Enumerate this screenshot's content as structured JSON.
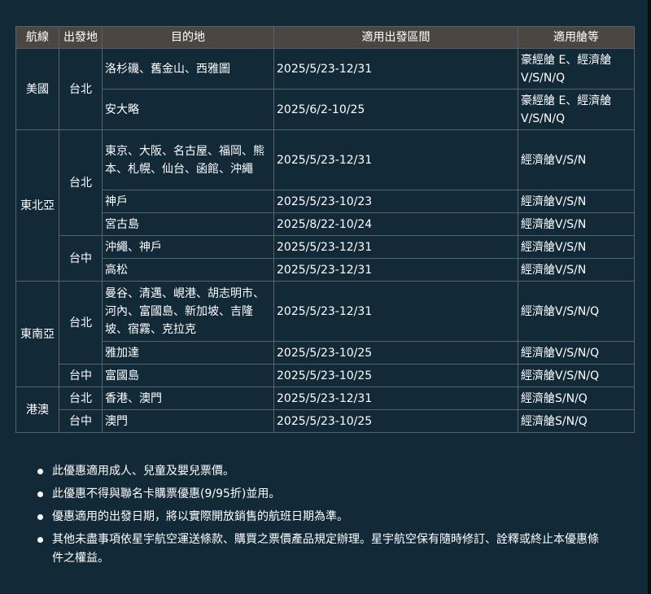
{
  "headers": {
    "route": "航線",
    "origin": "出發地",
    "destination": "目的地",
    "period": "適用出發區間",
    "cabin": "適用艙等"
  },
  "rows": [
    {
      "route": "美國",
      "origin": "台北",
      "destination": "洛杉磯、舊金山、西雅圖",
      "period": "2025/5/23-12/31",
      "cabin": "豪經艙 E、經濟艙V/S/N/Q"
    },
    {
      "destination": "安大略",
      "period": "2025/6/2-10/25",
      "cabin": "豪經艙 E、經濟艙V/S/N/Q"
    },
    {
      "route": "東北亞",
      "origin": "台北",
      "destination": "東京、大阪、名古屋、福岡、熊本、札幌、仙台、函館、沖繩",
      "period": "2025/5/23-12/31",
      "cabin": "經濟艙V/S/N"
    },
    {
      "destination": "神戶",
      "period": "2025/5/23-10/23",
      "cabin": "經濟艙V/S/N"
    },
    {
      "destination": "宮古島",
      "period": "2025/8/22-10/24",
      "cabin": "經濟艙V/S/N"
    },
    {
      "origin": "台中",
      "destination": "沖繩、神戶",
      "period": "2025/5/23-12/31",
      "cabin": "經濟艙V/S/N"
    },
    {
      "destination": "高松",
      "period": "2025/5/23-12/31",
      "cabin": "經濟艙V/S/N"
    },
    {
      "route": "東南亞",
      "origin": "台北",
      "destination": "曼谷、清邁、峴港、胡志明市、河內、富國島、新加坡、吉隆坡、宿霧、克拉克",
      "period": "2025/5/23-12/31",
      "cabin": "經濟艙V/S/N/Q"
    },
    {
      "destination": "雅加達",
      "period": "2025/5/23-10/25",
      "cabin": "經濟艙V/S/N/Q"
    },
    {
      "origin": "台中",
      "destination": "富國島",
      "period": "2025/5/23-10/25",
      "cabin": "經濟艙V/S/N/Q"
    },
    {
      "route": "港澳",
      "origin": "台北",
      "destination": "香港、澳門",
      "period": "2025/5/23-12/31",
      "cabin": "經濟艙S/N/Q"
    },
    {
      "origin": "台中",
      "destination": "澳門",
      "period": "2025/5/23-10/25",
      "cabin": "經濟艙S/N/Q"
    }
  ],
  "notes": [
    "此優惠適用成人、兒童及嬰兒票價。",
    "此優惠不得與聯名卡購票優惠(9/95折)並用。",
    "優惠適用的出發日期，將以實際開放銷售的航班日期為準。",
    "其他未盡事項依星宇航空運送條款、購買之票價產品規定辦理。星宇航空保有隨時修訂、詮釋或終止本優惠條件之權益。"
  ]
}
